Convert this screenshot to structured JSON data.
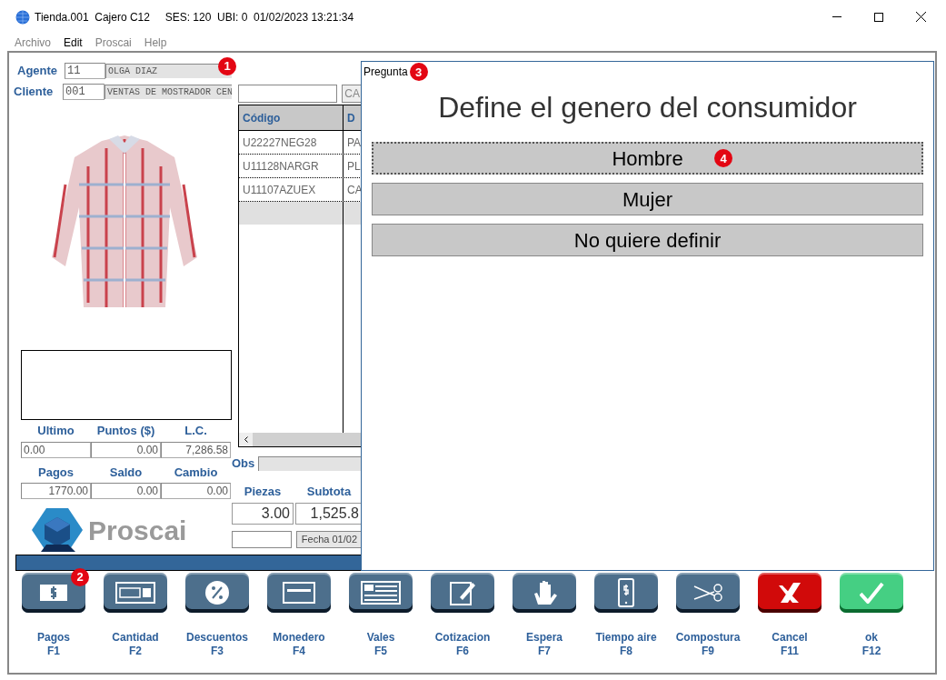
{
  "window": {
    "title": "Tienda.001  Cajero C12     SES: 120  UBI: 0  01/02/2023 13:21:34"
  },
  "menu": [
    {
      "label": "Archivo",
      "disabled": true
    },
    {
      "label": "Edit",
      "disabled": false
    },
    {
      "label": "Proscai",
      "disabled": true
    },
    {
      "label": "Help",
      "disabled": true
    }
  ],
  "agent": {
    "label": "Agente",
    "code": "11",
    "name": "OLGA DIAZ",
    "badge": "1"
  },
  "client": {
    "label": "Cliente",
    "code": "001",
    "name": "VENTAS DE MOSTRADOR CEN"
  },
  "totals_top": [
    {
      "label": "Ultimo",
      "value": "0.00"
    },
    {
      "label": "Puntos ($)",
      "value": "0.00"
    },
    {
      "label": "L.C.",
      "value": "7,286.58"
    }
  ],
  "totals_bottom": [
    {
      "label": "Pagos",
      "value": "1770.00"
    },
    {
      "label": "Saldo",
      "value": "0.00"
    },
    {
      "label": "Cambio",
      "value": "0.00"
    }
  ],
  "logo": {
    "text": "Proscai"
  },
  "search": {
    "button": "CA"
  },
  "table": {
    "columns": [
      "Código",
      "D"
    ],
    "rows": [
      [
        "U22227NEG28",
        "PA"
      ],
      [
        "U11128NARGR",
        "PL"
      ],
      [
        "U11107AZUEX",
        "CA"
      ]
    ]
  },
  "obs": {
    "label": "Obs"
  },
  "summary": [
    {
      "label": "Piezas",
      "value": "3.00"
    },
    {
      "label": "Subtota",
      "value": "1,525.8"
    }
  ],
  "date_button": "Fecha 01/02",
  "dialog": {
    "title": "Pregunta",
    "badge": "3",
    "question": "Define el genero del consumidor",
    "options": [
      {
        "label": "Hombre",
        "focused": true,
        "badge": "4"
      },
      {
        "label": "Mujer",
        "focused": false
      },
      {
        "label": "No quiere definir",
        "focused": false
      }
    ]
  },
  "actions": [
    {
      "label": "Pagos",
      "key": "F1",
      "kind": "normal",
      "badge": "2"
    },
    {
      "label": "Cantidad",
      "key": "F2",
      "kind": "normal"
    },
    {
      "label": "Descuentos",
      "key": "F3",
      "kind": "normal"
    },
    {
      "label": "Monedero",
      "key": "F4",
      "kind": "normal"
    },
    {
      "label": "Vales",
      "key": "F5",
      "kind": "normal"
    },
    {
      "label": "Cotizacion",
      "key": "F6",
      "kind": "normal"
    },
    {
      "label": "Espera",
      "key": "F7",
      "kind": "normal"
    },
    {
      "label": "Tiempo aire",
      "key": "F8",
      "kind": "normal"
    },
    {
      "label": "Compostura",
      "key": "F9",
      "kind": "normal"
    },
    {
      "label": "Cancel",
      "key": "F11",
      "kind": "cancel"
    },
    {
      "label": "ok",
      "key": "F12",
      "kind": "confirm"
    }
  ]
}
